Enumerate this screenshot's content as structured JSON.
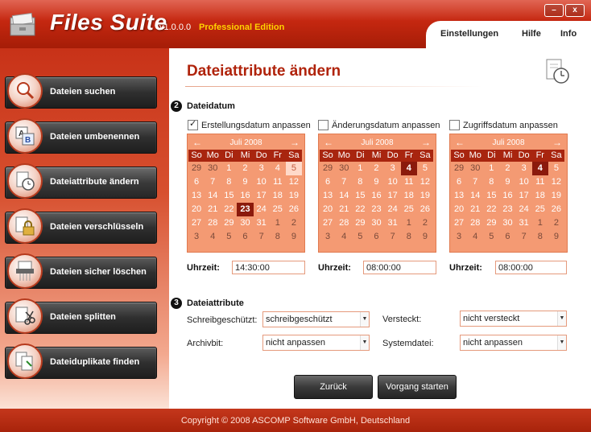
{
  "app": {
    "title": "Files Suite",
    "version": "v1.0.0.0",
    "edition": "Professional Edition",
    "window_buttons": {
      "minimize": "–",
      "close": "x"
    }
  },
  "topnav": {
    "items": [
      {
        "label": "Einstellungen"
      },
      {
        "label": "Hilfe"
      },
      {
        "label": "Info"
      }
    ]
  },
  "sidebar": {
    "items": [
      {
        "label": "Dateien suchen",
        "icon": "magnifier-icon"
      },
      {
        "label": "Dateien umbenennen",
        "icon": "rename-ab-icon"
      },
      {
        "label": "Dateiattribute ändern",
        "icon": "attributes-icon",
        "active": true
      },
      {
        "label": "Dateien verschlüsseln",
        "icon": "lock-icon"
      },
      {
        "label": "Dateien sicher löschen",
        "icon": "shredder-icon"
      },
      {
        "label": "Dateien splitten",
        "icon": "scissors-icon"
      },
      {
        "label": "Dateiduplikate finden",
        "icon": "duplicates-icon"
      }
    ]
  },
  "main": {
    "title": "Dateiattribute ändern",
    "section_date": {
      "number": "2",
      "title": "Dateidatum"
    },
    "section_attr": {
      "number": "3",
      "title": "Dateiattribute"
    },
    "calendars": [
      {
        "checkbox_label": "Erstellungsdatum anpassen",
        "checked": true,
        "month": "Juli 2008",
        "selected": "23",
        "today": "5",
        "time_label": "Uhrzeit:",
        "time": "14:30:00"
      },
      {
        "checkbox_label": "Änderungsdatum anpassen",
        "checked": false,
        "month": "Juli 2008",
        "selected": "4",
        "today": "",
        "time_label": "Uhrzeit:",
        "time": "08:00:00"
      },
      {
        "checkbox_label": "Zugriffsdatum anpassen",
        "checked": false,
        "month": "Juli 2008",
        "selected": "4",
        "today": "",
        "time_label": "Uhrzeit:",
        "time": "08:00:00"
      }
    ],
    "weekdays": [
      "So",
      "Mo",
      "Di",
      "Mi",
      "Do",
      "Fr",
      "Sa"
    ],
    "weeks": [
      [
        "29",
        "30",
        "1",
        "2",
        "3",
        "4",
        "5"
      ],
      [
        "6",
        "7",
        "8",
        "9",
        "10",
        "11",
        "12"
      ],
      [
        "13",
        "14",
        "15",
        "16",
        "17",
        "18",
        "19"
      ],
      [
        "20",
        "21",
        "22",
        "23",
        "24",
        "25",
        "26"
      ],
      [
        "27",
        "28",
        "29",
        "30",
        "31",
        "1",
        "2"
      ],
      [
        "3",
        "4",
        "5",
        "6",
        "7",
        "8",
        "9"
      ]
    ],
    "attributes": {
      "readonly_label": "Schreibgeschützt:",
      "readonly_value": "schreibgeschützt",
      "hidden_label": "Versteckt:",
      "hidden_value": "nicht versteckt",
      "archive_label": "Archivbit:",
      "archive_value": "nicht anpassen",
      "system_label": "Systemdatei:",
      "system_value": "nicht anpassen"
    },
    "buttons": {
      "back": "Zurück",
      "start": "Vorgang starten"
    }
  },
  "footer": {
    "text": "Copyright © 2008 ASCOMP Software GmbH, Deutschland"
  },
  "colors": {
    "accent": "#c42710",
    "calendar_bg": "#f49a73",
    "calendar_header": "#a8250f",
    "selected_day": "#8b1a0c"
  }
}
